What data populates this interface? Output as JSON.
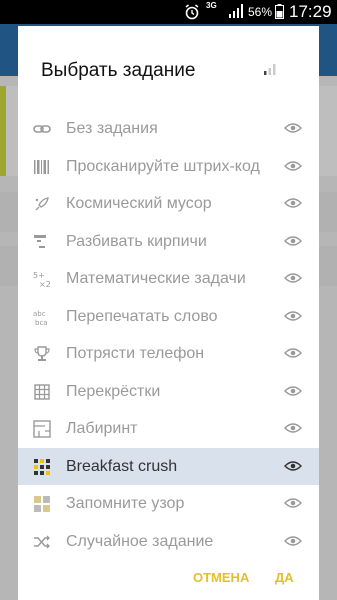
{
  "status_bar": {
    "network": "3G",
    "battery": "56%",
    "time": "17:29"
  },
  "dialog": {
    "title": "Выбрать задание",
    "tasks": [
      {
        "label": "Без задания",
        "icon": "link-icon",
        "selected": false
      },
      {
        "label": "Просканируйте штрих-код",
        "icon": "barcode-icon",
        "selected": false
      },
      {
        "label": "Космический мусор",
        "icon": "rocket-icon",
        "selected": false
      },
      {
        "label": "Разбивать кирпичи",
        "icon": "bricks-icon",
        "selected": false
      },
      {
        "label": "Математические задачи",
        "icon": "math-icon",
        "selected": false
      },
      {
        "label": "Перепечатать слово",
        "icon": "retype-icon",
        "selected": false
      },
      {
        "label": "Потрясти телефон",
        "icon": "trophy-icon",
        "selected": false
      },
      {
        "label": "Перекрёстки",
        "icon": "crossroads-icon",
        "selected": false
      },
      {
        "label": "Лабиринт",
        "icon": "maze-icon",
        "selected": false
      },
      {
        "label": "Breakfast crush",
        "icon": "grid-candy-icon",
        "selected": true
      },
      {
        "label": "Запомните узор",
        "icon": "pattern-icon",
        "selected": false
      },
      {
        "label": "Случайное задание",
        "icon": "shuffle-icon",
        "selected": false
      }
    ],
    "cancel_label": "ОТМЕНА",
    "ok_label": "ДА"
  },
  "colors": {
    "accent": "#e3c02a",
    "selected_row": "#d8e1ec",
    "muted_text": "#9a9a9a"
  }
}
